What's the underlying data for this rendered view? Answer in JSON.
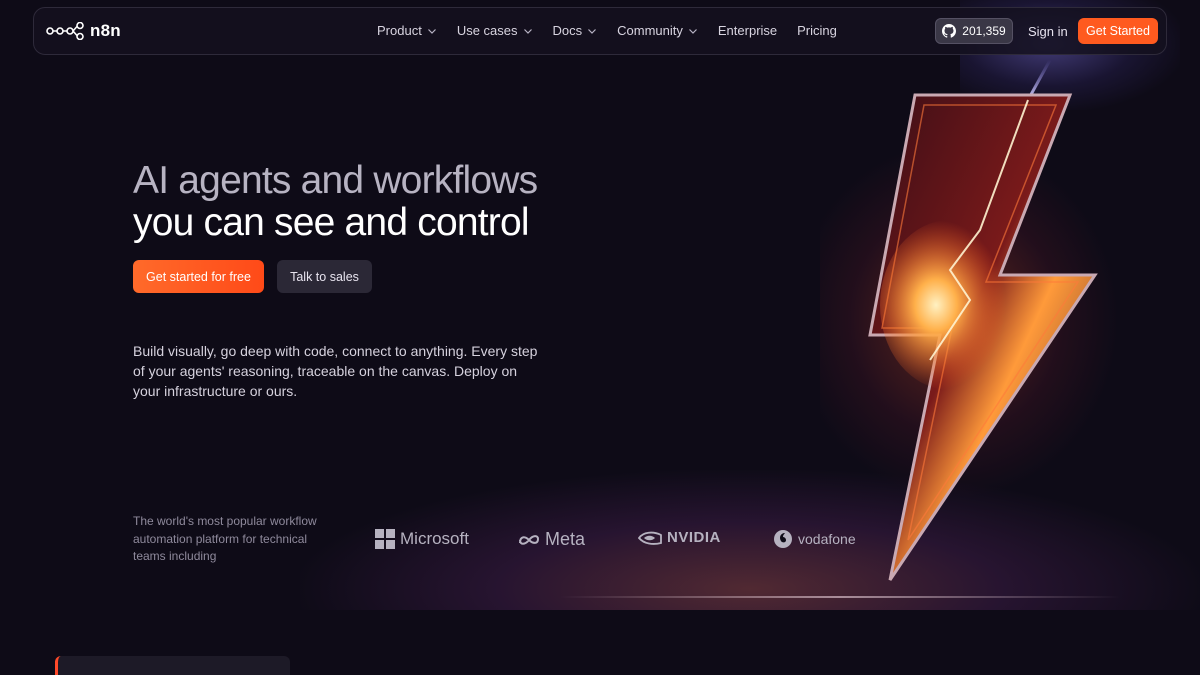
{
  "nav": {
    "brand": "n8n",
    "links": [
      {
        "label": "Product",
        "dropdown": true
      },
      {
        "label": "Use cases",
        "dropdown": true
      },
      {
        "label": "Docs",
        "dropdown": true
      },
      {
        "label": "Community",
        "dropdown": true
      },
      {
        "label": "Enterprise",
        "dropdown": false
      },
      {
        "label": "Pricing",
        "dropdown": false
      }
    ],
    "github_stars": "201,359",
    "sign_in": "Sign in",
    "get_started": "Get Started"
  },
  "hero": {
    "headline_line1": "AI agents and workflows",
    "headline_line2": "you can see and control",
    "cta_primary": "Get started for free",
    "cta_secondary": "Talk to sales",
    "subcopy": "Build visually, go deep with code, connect to anything. Every step of your agents' reasoning, traceable on the canvas. Deploy on your infrastructure or ours."
  },
  "trust": {
    "text": "The world's most popular workflow automation platform for technical teams including",
    "brands": [
      "Microsoft",
      "Meta",
      "NVIDIA",
      "vodafone"
    ]
  },
  "colors": {
    "accent": "#ff5a1f",
    "background": "#0e0b17"
  }
}
